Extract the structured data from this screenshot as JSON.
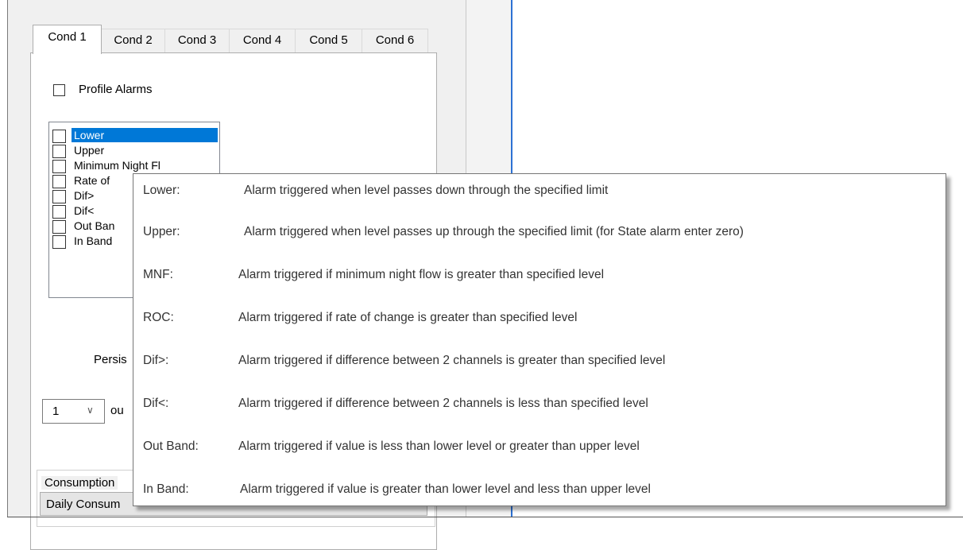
{
  "tabs": [
    "Cond 1",
    "Cond 2",
    "Cond 3",
    "Cond 4",
    "Cond 5",
    "Cond 6"
  ],
  "active_tab": "Cond 1",
  "profile_alarms": {
    "label": "Profile Alarms",
    "checked": false
  },
  "alarm_list": {
    "items": [
      {
        "label": "Lower",
        "checked": false,
        "selected": true
      },
      {
        "label": "Upper",
        "checked": false,
        "selected": false
      },
      {
        "label": "Minimum Night Fl",
        "checked": false,
        "selected": false
      },
      {
        "label": "Rate of",
        "checked": false,
        "selected": false
      },
      {
        "label": "Dif>",
        "checked": false,
        "selected": false
      },
      {
        "label": "Dif<",
        "checked": false,
        "selected": false
      },
      {
        "label": "Out Ban",
        "checked": false,
        "selected": false
      },
      {
        "label": "In Band",
        "checked": false,
        "selected": false
      }
    ]
  },
  "persistence": {
    "label": "Persis",
    "value": "1",
    "suffix": "ou"
  },
  "consumption": {
    "title": "Consumption",
    "select_value": "Daily Consum"
  },
  "tooltip": {
    "rows": [
      {
        "key": "Lower:",
        "desc": "Alarm triggered when level passes down through the specified limit"
      },
      {
        "key": "Upper:",
        "desc": "Alarm triggered when level passes up through the specified limit (for State alarm enter zero)"
      },
      {
        "key": "MNF:",
        "desc": "Alarm triggered  if minimum night flow is greater than specified level"
      },
      {
        "key": "ROC:",
        "desc": "Alarm triggered if rate of change is greater than specified level"
      },
      {
        "key": "Dif>:",
        "desc": "Alarm triggered if difference between 2 channels is greater than specified level"
      },
      {
        "key": "Dif<:",
        "desc": "Alarm triggered if difference between 2 channels is less than specified level"
      },
      {
        "key": "Out Band:",
        "desc": "Alarm triggered if value is less than lower level or greater than upper level"
      },
      {
        "key": "In Band:",
        "desc": "Alarm triggered if value is greater than lower level and less than upper level"
      }
    ]
  },
  "colors": {
    "selection": "#0078d7",
    "accent_line": "#2d72d4",
    "panel_bg": "#f0f0f0"
  }
}
